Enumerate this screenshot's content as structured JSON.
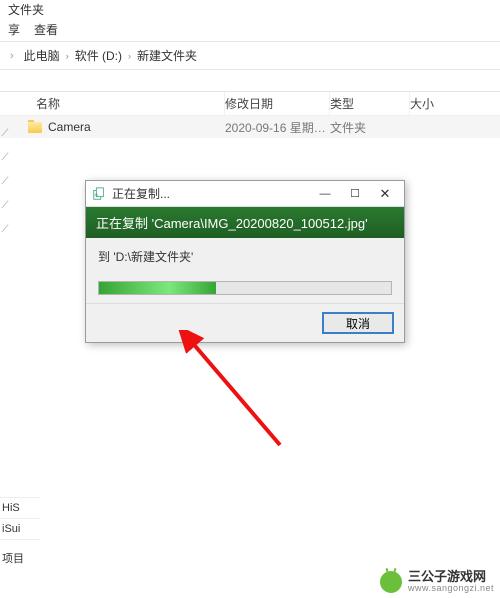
{
  "window": {
    "title_fragment": "文件夹"
  },
  "menu": {
    "share": "享",
    "view": "查看"
  },
  "breadcrumb": {
    "items": [
      "此电脑",
      "软件 (D:)",
      "新建文件夹"
    ],
    "sep": "›"
  },
  "columns": {
    "name": "名称",
    "date": "修改日期",
    "type": "类型",
    "size": "大小"
  },
  "rows": [
    {
      "name": "Camera",
      "date": "2020-09-16 星期…",
      "type": "文件夹",
      "size": ""
    }
  ],
  "sidebar_bottom": {
    "a": "HiS",
    "b": "iSui",
    "tail": "项目"
  },
  "dialog": {
    "title": "正在复制...",
    "band": "正在复制 'Camera\\IMG_20200820_100512.jpg'",
    "dest": "到 'D:\\新建文件夹'",
    "progress_percent": 40,
    "cancel": "取消"
  },
  "watermark": {
    "name": "三公子游戏网",
    "url": "www.sangongzi.net"
  }
}
